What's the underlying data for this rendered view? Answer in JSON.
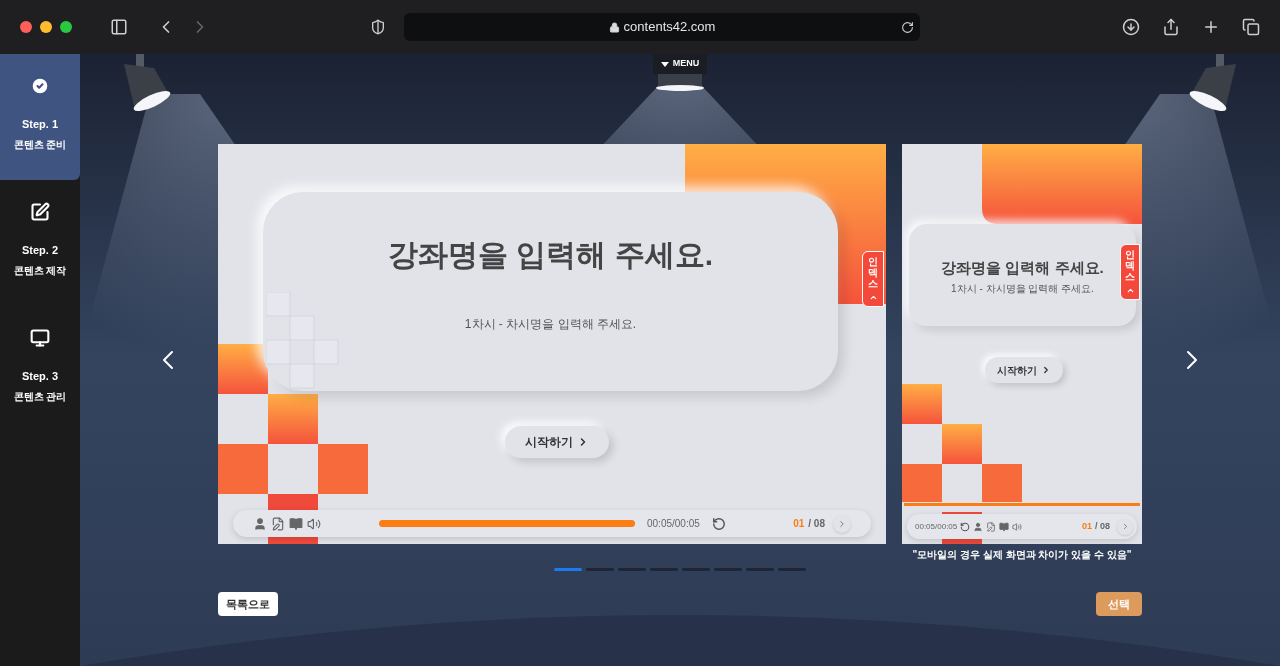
{
  "browser": {
    "url": "contents42.com"
  },
  "menu_button": "MENU",
  "steps": [
    {
      "kind": "check",
      "label": "Step. 1",
      "title": "콘텐츠 준비",
      "selected": true
    },
    {
      "kind": "edit",
      "label": "Step. 2",
      "title": "콘텐츠 제작",
      "selected": false
    },
    {
      "kind": "monitor",
      "label": "Step. 3",
      "title": "콘텐츠 관리",
      "selected": false
    }
  ],
  "desktop": {
    "title": "강좌명을 입력해 주세요.",
    "subtitle": "1차시 - 차시명을 입력해 주세요.",
    "start_button": "시작하기",
    "index_tab": "인덱스",
    "time": "00:05/00:05",
    "page_current": "01",
    "page_total": "/ 08"
  },
  "mobile": {
    "title": "강좌명을 입력해 주세요.",
    "subtitle": "1차시 - 차시명을 입력해 주세요.",
    "start_button": "시작하기",
    "index_tab": "인덱스",
    "time": "00:05/00:05",
    "page_current": "01",
    "page_total": "/ 08"
  },
  "mobile_caption": "\"모바일의 경우 실제 화면과 차이가 있을 수 있음\"",
  "pagination": [
    {
      "selected": true
    },
    {
      "selected": false
    },
    {
      "selected": false
    },
    {
      "selected": false
    },
    {
      "selected": false
    },
    {
      "selected": false
    },
    {
      "selected": false
    },
    {
      "selected": false
    }
  ],
  "buttons": {
    "back": "목록으로",
    "select": "선택"
  }
}
